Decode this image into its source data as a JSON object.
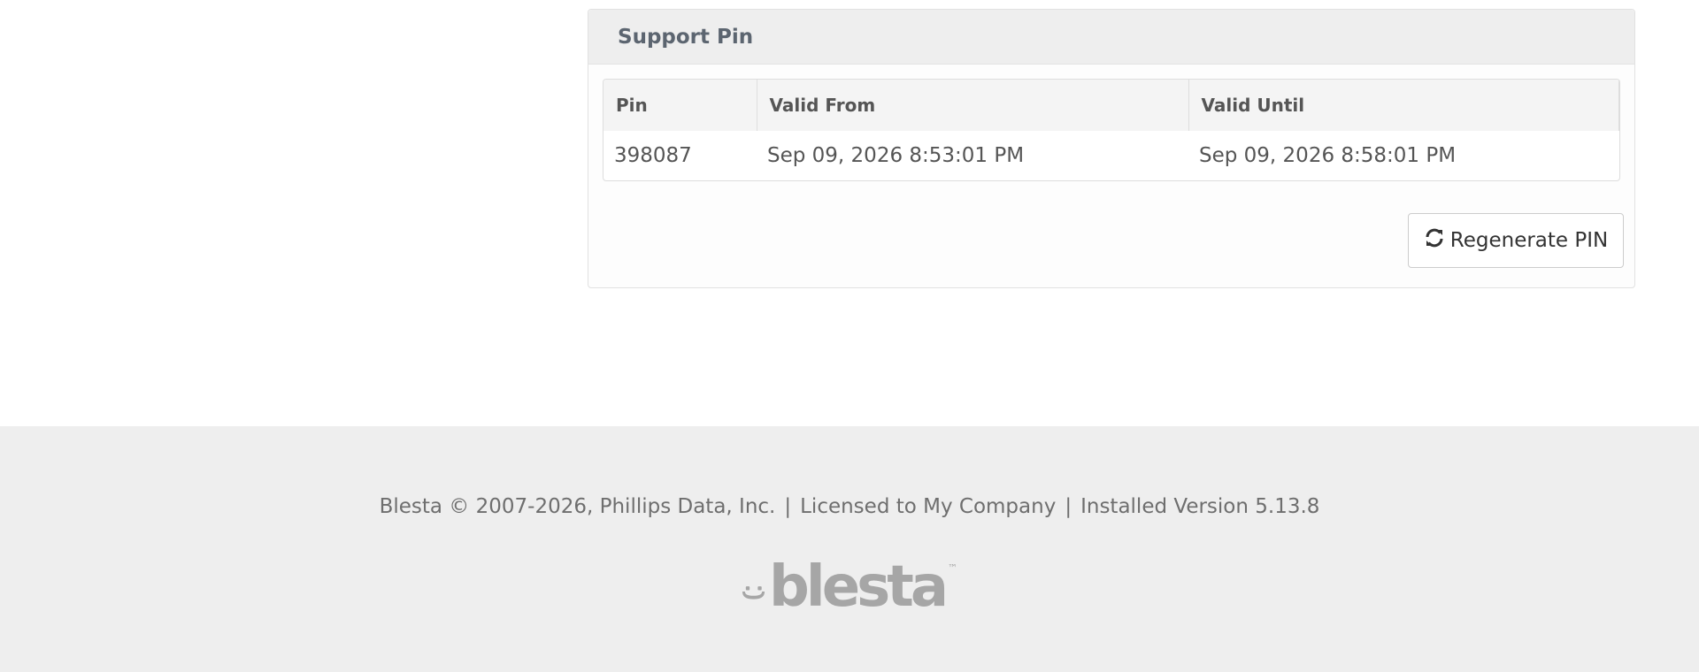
{
  "panel": {
    "title": "Support Pin"
  },
  "table": {
    "headers": [
      "Pin",
      "Valid From",
      "Valid Until"
    ],
    "rows": [
      [
        "398087",
        "Sep 09, 2026 8:53:01 PM",
        "Sep 09, 2026 8:58:01 PM"
      ]
    ]
  },
  "actions": {
    "regenerate_label": "Regenerate PIN",
    "regenerate_icon": "refresh-icon"
  },
  "footer": {
    "copyright": "Blesta © 2007-2026, Phillips Data, Inc.",
    "separator": "|",
    "license": "Licensed to My Company",
    "version": "Installed Version 5.13.8",
    "logo_text": "blesta",
    "logo_tm": "™"
  }
}
